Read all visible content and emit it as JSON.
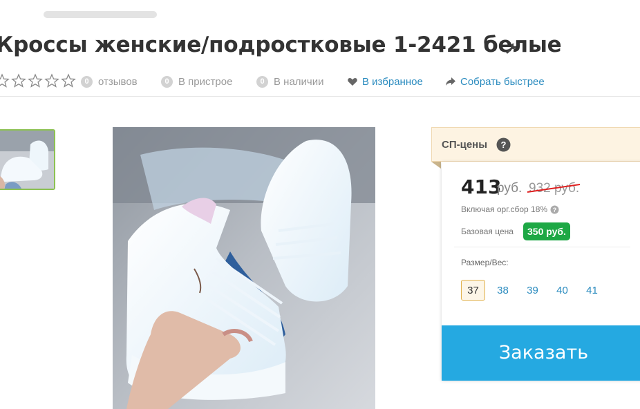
{
  "product": {
    "title": "Кроссы женские/подростковые 1-2421 белые"
  },
  "meta": {
    "reviews_count": "0",
    "reviews_label": "отзывов",
    "attach_count": "0",
    "attach_label": "В пристрое",
    "stock_count": "0",
    "stock_label": "В наличии",
    "favorite_label": "В избранное",
    "collect_label": "Собрать быстрее"
  },
  "sp": {
    "title": "СП-цены"
  },
  "price": {
    "current": "413",
    "currency": "руб.",
    "old": "932 руб.",
    "fee_note": "Включая орг.сбор 18%",
    "base_label": "Базовая цена",
    "base_value": "350 руб."
  },
  "sizes": {
    "label": "Размер/Вес:",
    "options": [
      "37",
      "38",
      "39",
      "40",
      "41"
    ],
    "selected": "37"
  },
  "order": {
    "button_label": "Заказать"
  },
  "colors": {
    "accent_blue": "#25a9e1",
    "link_blue": "#2a8bbf",
    "base_price_green": "#1ea845",
    "thumb_border": "#8cc152"
  }
}
